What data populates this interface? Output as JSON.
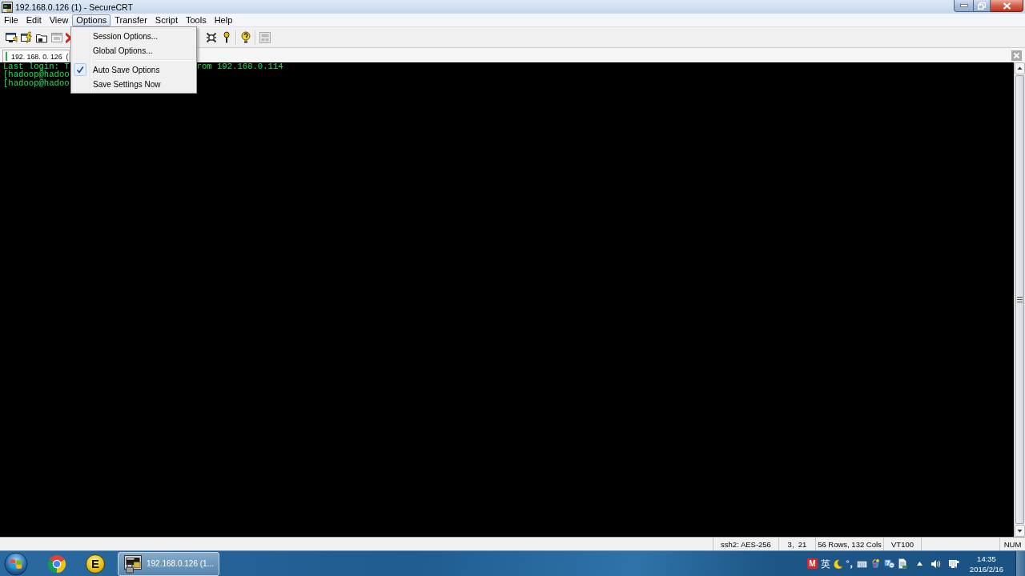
{
  "window": {
    "title": "192.168.0.126 (1) - SecureCRT"
  },
  "menu_bar": [
    {
      "label": "File",
      "selected": false
    },
    {
      "label": "Edit",
      "selected": false
    },
    {
      "label": "View",
      "selected": false
    },
    {
      "label": "Options",
      "selected": true
    },
    {
      "label": "Transfer",
      "selected": false
    },
    {
      "label": "Script",
      "selected": false
    },
    {
      "label": "Tools",
      "selected": false
    },
    {
      "label": "Help",
      "selected": false
    }
  ],
  "options_menu": {
    "items": [
      {
        "kind": "item",
        "label": "Session Options...",
        "checked": false
      },
      {
        "kind": "item",
        "label": "Global Options...",
        "checked": false
      },
      {
        "kind": "separator"
      },
      {
        "kind": "item",
        "label": "Auto Save Options",
        "checked": true
      },
      {
        "kind": "item",
        "label": "Save Settings Now",
        "checked": false
      }
    ]
  },
  "toolbar": [
    {
      "kind": "monitor",
      "disabled": false
    },
    {
      "kind": "bolt",
      "disabled": false
    },
    {
      "kind": "folder",
      "disabled": false
    },
    {
      "kind": "window",
      "disabled": true
    },
    {
      "kind": "cross",
      "disabled": false
    },
    {
      "kind": "gap"
    },
    {
      "kind": "gear",
      "disabled": false
    },
    {
      "kind": "pin",
      "disabled": false
    },
    {
      "kind": "separator"
    },
    {
      "kind": "help",
      "disabled": false
    },
    {
      "kind": "separator"
    },
    {
      "kind": "panel",
      "disabled": true
    }
  ],
  "tab_bar": {
    "tabs": [
      {
        "label": "192. 168. 0. 126  (",
        "selected": true
      }
    ]
  },
  "terminal": {
    "lines": [
      {
        "parts": [
          "Last login: T",
          "rom 192.168.0.114"
        ]
      },
      {
        "parts": [
          "[hadoop@hadoo"
        ]
      },
      {
        "parts": [
          "[hadoop@hadoo"
        ]
      }
    ]
  },
  "status_bar": {
    "panels": [
      "ssh2: AES-256",
      "3,  21",
      "56 Rows, 132 Cols",
      "VT100",
      "NUM"
    ]
  },
  "taskbar": {
    "pinned": [
      {
        "kind": "orb"
      },
      {
        "kind": "ring"
      },
      {
        "kind": "disc",
        "text": "E"
      }
    ],
    "windows": [
      {
        "label": "192.168.0.126 (1...",
        "selected": true
      }
    ],
    "tray": {
      "badge": "M",
      "ime_mode": "英",
      "time": "14:35",
      "date": "2016/2/16"
    }
  }
}
